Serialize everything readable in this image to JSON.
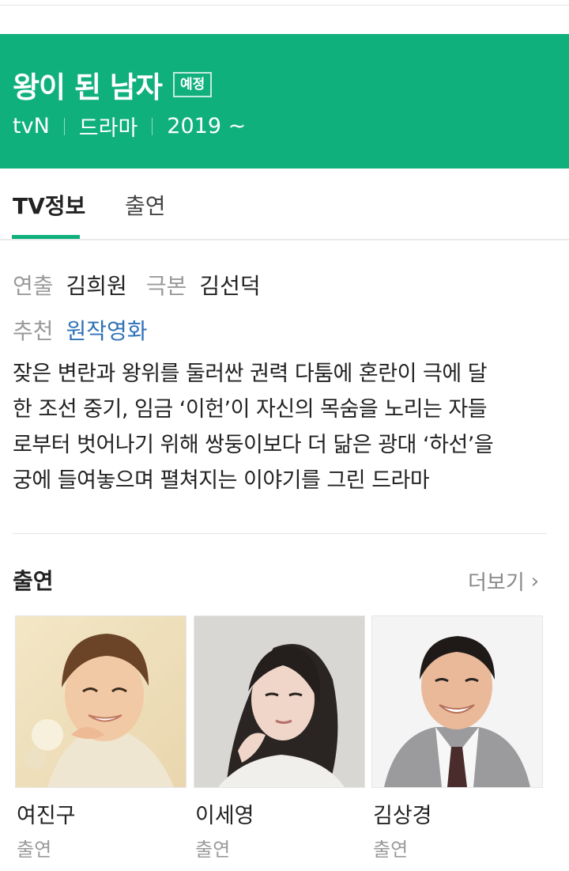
{
  "header": {
    "title": "왕이 된 남자",
    "badge": "예정",
    "meta": [
      "tvN",
      "드라마",
      "2019 ~"
    ],
    "color": "#10b07c"
  },
  "tabs": [
    {
      "label": "TV정보",
      "active": true
    },
    {
      "label": "출연",
      "active": false
    }
  ],
  "info": {
    "director_label": "연출",
    "director": "김희원",
    "writer_label": "극본",
    "writer": "김선덕",
    "recommend_label": "추천",
    "recommend": "원작영화"
  },
  "description_lines": [
    "잦은 변란과 왕위를 둘러싼 권력 다툼에 혼란이 극에 달",
    "한 조선 중기, 임금 ‘이헌’이 자신의 목숨을 노리는 자들",
    "로부터 벗어나기 위해 쌍둥이보다 더 닮은 광대 ‘하선’을",
    "궁에 들여놓으며 펼쳐지는 이야기를 그린 드라마"
  ],
  "cast_section": {
    "title": "출연",
    "more": "더보기",
    "members": [
      {
        "name": "여진구",
        "role": "출연"
      },
      {
        "name": "이세영",
        "role": "출연"
      },
      {
        "name": "김상경",
        "role": "출연"
      }
    ]
  }
}
